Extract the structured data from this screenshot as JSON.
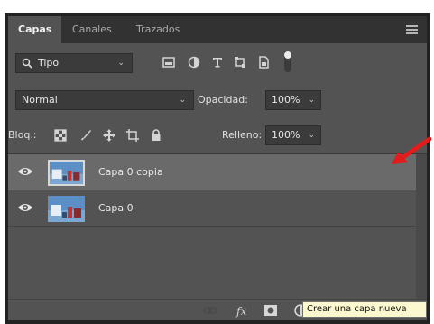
{
  "tabs": [
    {
      "label": "Capas",
      "active": true
    },
    {
      "label": "Canales",
      "active": false
    },
    {
      "label": "Trazados",
      "active": false
    }
  ],
  "filter": {
    "kind_label": "Tipo",
    "filter_icons": [
      "image-filter-icon",
      "adjustment-filter-icon",
      "type-filter-icon",
      "shape-filter-icon",
      "smart-object-filter-icon",
      "filter-toggle-icon"
    ]
  },
  "blend": {
    "mode": "Normal",
    "opacity_label": "Opacidad:",
    "opacity_value": "100%"
  },
  "lock": {
    "label": "Bloq.:",
    "fill_label": "Relleno:",
    "fill_value": "100%"
  },
  "layers": [
    {
      "name": "Capa 0 copia",
      "selected": true,
      "visible": true
    },
    {
      "name": "Capa 0",
      "selected": false,
      "visible": true
    }
  ],
  "bottom_icons": [
    "link-layers-icon",
    "fx-icon",
    "add-mask-icon",
    "adjustment-layer-icon",
    "new-group-icon",
    "new-layer-icon",
    "delete-icon"
  ],
  "tooltip": {
    "text": "Crear una capa nueva"
  },
  "colors": {
    "accent_arrow": "#e31b1b",
    "panel": "#535353",
    "selected_row": "#6a6a6a"
  }
}
